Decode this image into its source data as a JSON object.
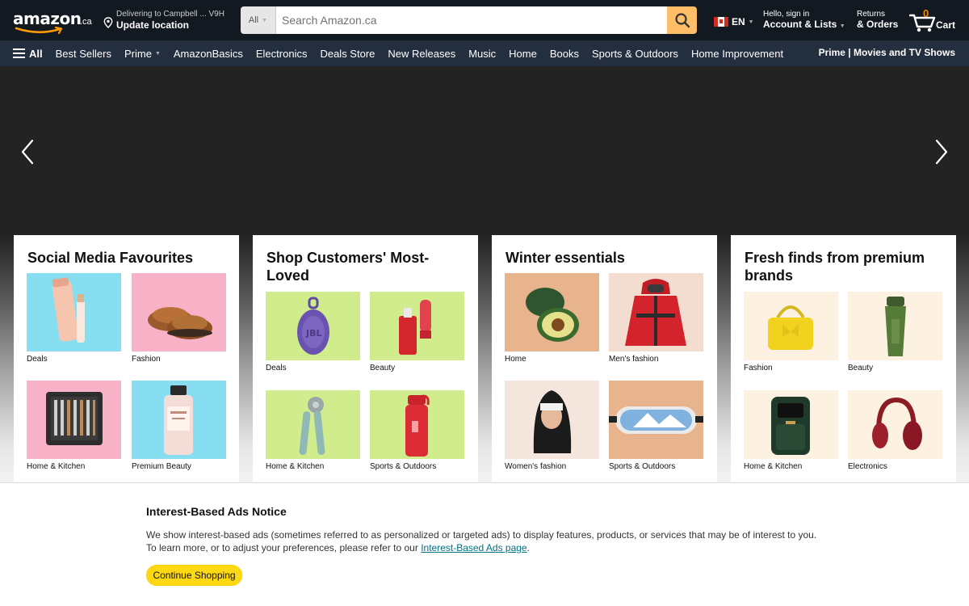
{
  "header": {
    "logo_text": "amazon",
    "logo_tld": ".ca",
    "deliver_line1": "Delivering to Campbell ... V9H",
    "deliver_line2": "Update location",
    "search_category": "All",
    "search_placeholder": "Search Amazon.ca",
    "language": "EN",
    "account_line1": "Hello, sign in",
    "account_line2": "Account & Lists",
    "returns_line1": "Returns",
    "returns_line2": "& Orders",
    "cart_count": "0",
    "cart_label": "Cart"
  },
  "subnav": {
    "all_label": "All",
    "links": [
      "Best Sellers",
      "Prime",
      "AmazonBasics",
      "Electronics",
      "Deals Store",
      "New Releases",
      "Music",
      "Home",
      "Books",
      "Sports & Outdoors",
      "Home Improvement"
    ],
    "promo": "Prime | Movies and TV Shows"
  },
  "cards": [
    {
      "title": "Social Media Favourites",
      "tiles": [
        {
          "label": "Deals",
          "icon": "skincare-tube-icon",
          "bg": "#86def0"
        },
        {
          "label": "Fashion",
          "icon": "slippers-icon",
          "bg": "#f7b2c7"
        },
        {
          "label": "Home & Kitchen",
          "icon": "utensil-set-icon",
          "bg": "#f7b2c7"
        },
        {
          "label": "Premium Beauty",
          "icon": "shampoo-bottle-icon",
          "bg": "#86def0"
        }
      ]
    },
    {
      "title": "Shop Customers' Most-Loved",
      "tiles": [
        {
          "label": "Deals",
          "icon": "speaker-icon",
          "bg": "#d0ec8c"
        },
        {
          "label": "Beauty",
          "icon": "lip-oil-icon",
          "bg": "#d0ec8c"
        },
        {
          "label": "Home & Kitchen",
          "icon": "can-opener-icon",
          "bg": "#d0ec8c"
        },
        {
          "label": "Sports & Outdoors",
          "icon": "water-bottle-icon",
          "bg": "#d0ec8c"
        }
      ]
    },
    {
      "title": "Winter essentials",
      "tiles": [
        {
          "label": "Home",
          "icon": "avocado-warmer-icon",
          "bg": "#e7b48e"
        },
        {
          "label": "Men's fashion",
          "icon": "red-jacket-icon",
          "bg": "#f3ddd0"
        },
        {
          "label": "Women's fashion",
          "icon": "balaclava-icon",
          "bg": "#f4e6dc"
        },
        {
          "label": "Sports & Outdoors",
          "icon": "ski-goggles-icon",
          "bg": "#e7b48e"
        }
      ]
    },
    {
      "title": "Fresh finds from premium brands",
      "tiles": [
        {
          "label": "Fashion",
          "icon": "yellow-handbag-icon",
          "bg": "#fdf1e2"
        },
        {
          "label": "Beauty",
          "icon": "green-tube-icon",
          "bg": "#fdf1e2"
        },
        {
          "label": "Home & Kitchen",
          "icon": "air-fryer-icon",
          "bg": "#fdf1e2"
        },
        {
          "label": "Electronics",
          "icon": "headphones-icon",
          "bg": "#fdf1e2"
        }
      ]
    }
  ],
  "notice": {
    "title": "Interest-Based Ads Notice",
    "body_text": "We show interest-based ads (sometimes referred to as personalized or targeted ads) to display features, products, or services that may be of interest to you. To learn more, or to adjust your preferences, please refer to our",
    "link_text": "Interest-Based Ads page",
    "body_end": ".",
    "button_label": "Continue Shopping"
  },
  "colors": {
    "header_bg": "#131921",
    "subnav_bg": "#232f3e",
    "search_button": "#febd69",
    "cart_count": "#f08804",
    "continue_button": "#ffd814",
    "link": "#007185"
  }
}
